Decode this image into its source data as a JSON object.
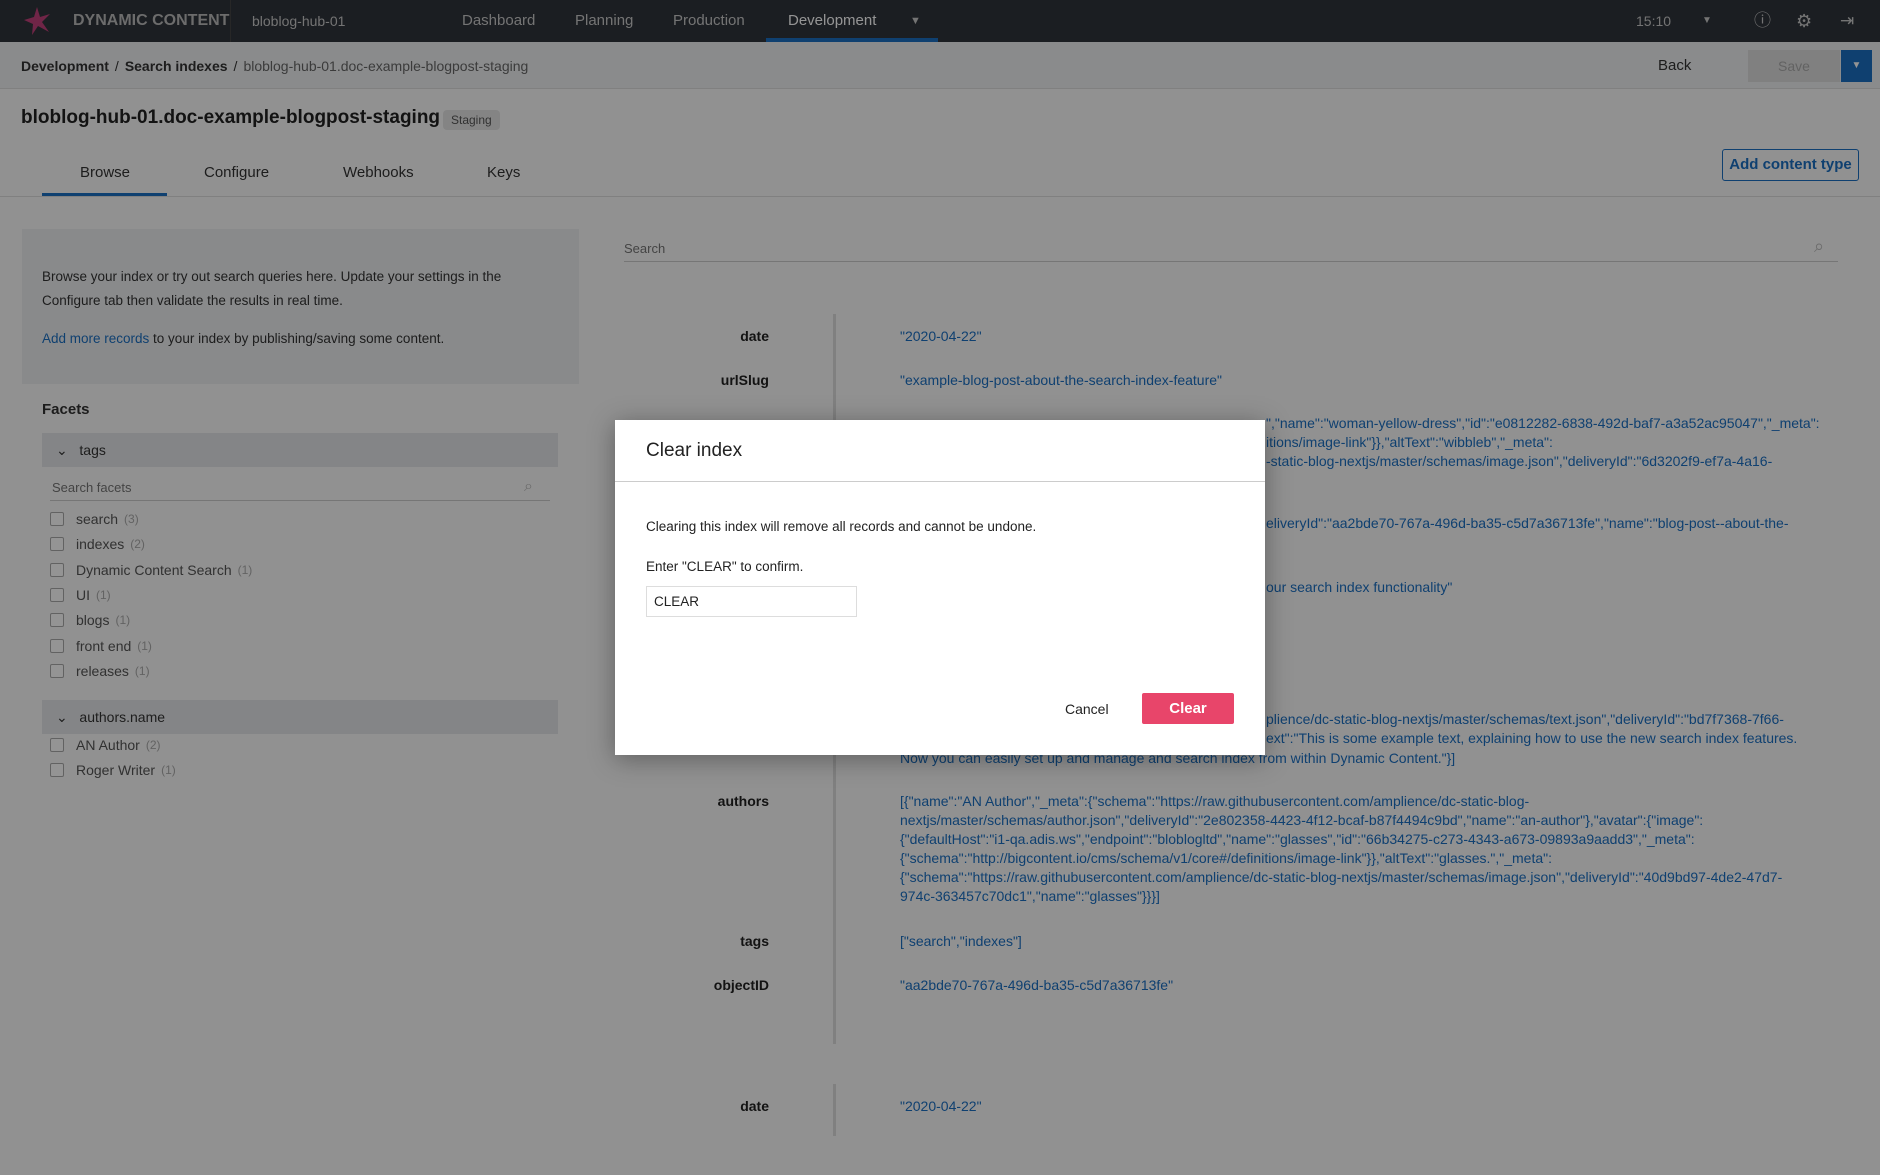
{
  "topbar": {
    "brand": "DYNAMIC CONTENT",
    "hub": "bloblog-hub-01",
    "nav": [
      "Dashboard",
      "Planning",
      "Production",
      "Development"
    ],
    "time": "15:10"
  },
  "breadcrumb": {
    "items": [
      "Development",
      "Search indexes",
      "bloblog-hub-01.doc-example-blogpost-staging"
    ],
    "back": "Back",
    "save": "Save"
  },
  "page": {
    "title": "bloblog-hub-01.doc-example-blogpost-staging",
    "badge": "Staging",
    "add_content_type": "Add content type"
  },
  "tabs": [
    "Browse",
    "Configure",
    "Webhooks",
    "Keys"
  ],
  "info": {
    "text": "Browse your index or try out search queries here. Update your settings in the Configure tab then validate the results in real time.",
    "link": "Add more records",
    "link_suffix": " to your index by publishing/saving some content."
  },
  "facets": {
    "title": "Facets",
    "search_placeholder": "Search facets",
    "groups": [
      {
        "name": "tags",
        "items": [
          {
            "label": "search",
            "count": "(3)"
          },
          {
            "label": "indexes",
            "count": "(2)"
          },
          {
            "label": "Dynamic Content Search",
            "count": "(1)"
          },
          {
            "label": "UI",
            "count": "(1)"
          },
          {
            "label": "blogs",
            "count": "(1)"
          },
          {
            "label": "front end",
            "count": "(1)"
          },
          {
            "label": "releases",
            "count": "(1)"
          }
        ]
      },
      {
        "name": "authors.name",
        "items": [
          {
            "label": "AN Author",
            "count": "(2)"
          },
          {
            "label": "Roger Writer",
            "count": "(1)"
          }
        ]
      }
    ]
  },
  "search": {
    "placeholder": "Search"
  },
  "record": {
    "date": {
      "label": "date",
      "value": "\"2020-04-22\""
    },
    "urlSlug": {
      "label": "urlSlug",
      "value": "\"example-blog-post-about-the-search-index-feature\""
    },
    "fragments": [
      "\",\"name\":\"woman-yellow-dress\",\"id\":\"e0812282-6838-492d-baf7-a3a52ac95047\",\"_meta\":",
      "itions/image-link\"}},\"altText\":\"wibbleb\",\"_meta\":",
      "-static-blog-nextjs/master/schemas/image.json\",\"deliveryId\":\"6d3202f9-ef7a-4a16-",
      "eliveryId\":\"aa2bde70-767a-496d-ba35-c5d7a36713fe\",\"name\":\"blog-post--about-the-",
      "our search index functionality\"",
      "plience/dc-static-blog-nextjs/master/schemas/text.json\",\"deliveryId\":\"bd7f7368-7f66-",
      "ext\":\"This is some example text, explaining how to use the new search index features."
    ],
    "text_tail": "Now you can easily set up and manage and search index from within Dynamic Content.\"}]",
    "authors": {
      "label": "authors",
      "value": "[{\"name\":\"AN Author\",\"_meta\":{\"schema\":\"https://raw.githubusercontent.com/amplience/dc-static-blog-nextjs/master/schemas/author.json\",\"deliveryId\":\"2e802358-4423-4f12-bcaf-b87f4494c9bd\",\"name\":\"an-author\"},\"avatar\":{\"image\":{\"defaultHost\":\"i1-qa.adis.ws\",\"endpoint\":\"bloblogltd\",\"name\":\"glasses\",\"id\":\"66b34275-c273-4343-a673-09893a9aadd3\",\"_meta\":{\"schema\":\"http://bigcontent.io/cms/schema/v1/core#/definitions/image-link\"}},\"altText\":\"glasses.\",\"_meta\":{\"schema\":\"https://raw.githubusercontent.com/amplience/dc-static-blog-nextjs/master/schemas/image.json\",\"deliveryId\":\"40d9bd97-4de2-47d7-974c-363457c70dc1\",\"name\":\"glasses\"}}}]"
    },
    "tags": {
      "label": "tags",
      "value": "[\"search\",\"indexes\"]"
    },
    "objectID": {
      "label": "objectID",
      "value": "\"aa2bde70-767a-496d-ba35-c5d7a36713fe\""
    },
    "date2": {
      "label": "date",
      "value": "\"2020-04-22\""
    }
  },
  "modal": {
    "title": "Clear index",
    "message": "Clearing this index will remove all records and cannot be undone.",
    "prompt": "Enter \"CLEAR\" to confirm.",
    "input_value": "CLEAR",
    "cancel": "Cancel",
    "confirm": "Clear"
  },
  "colors": {
    "accent": "#1b6fc2",
    "danger": "#e8456a"
  }
}
